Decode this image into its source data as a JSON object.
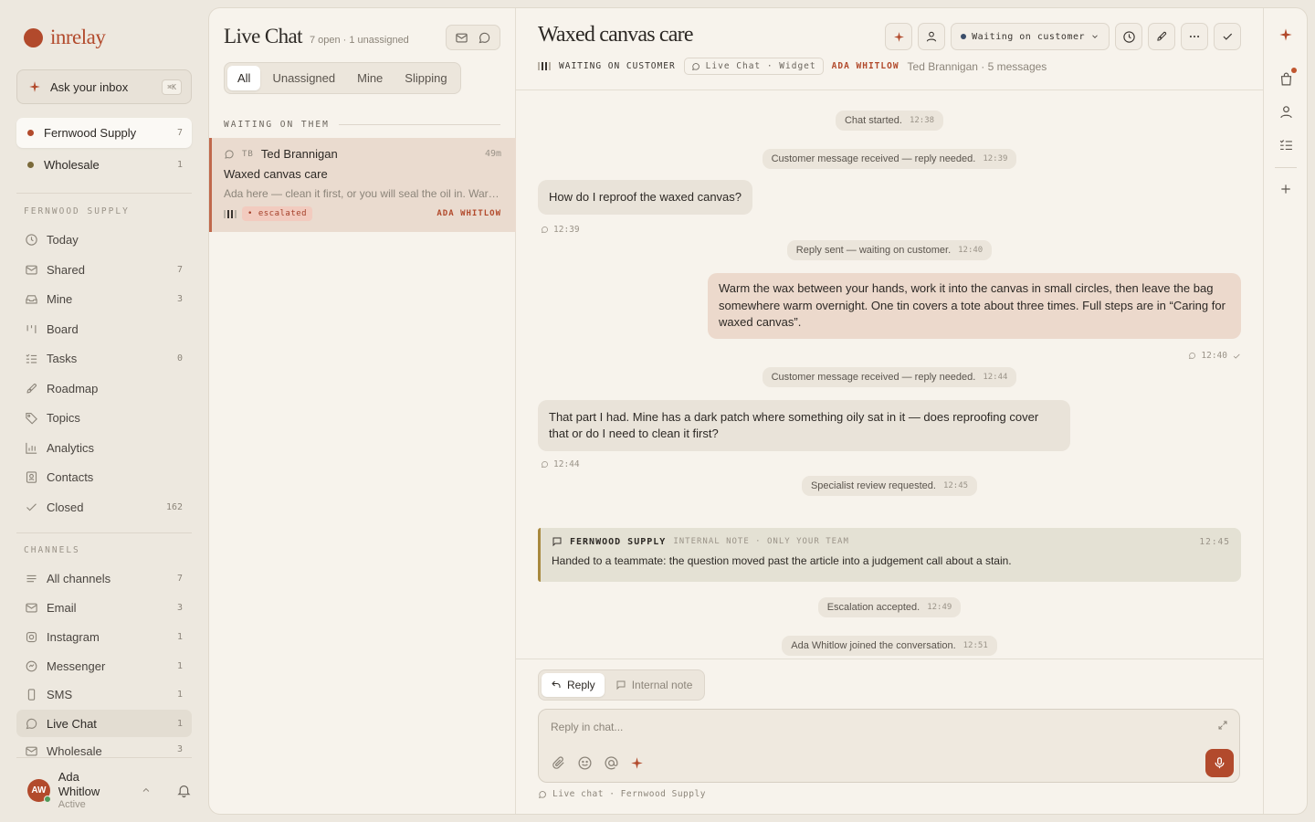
{
  "app": {
    "name": "inrelay",
    "ask_label": "Ask your inbox",
    "ask_shortcut": "⌘K",
    "accent": "#b24a2c"
  },
  "workspaces": [
    {
      "name": "Fernwood Supply",
      "count": "7",
      "dot_color": "#b24a2c"
    },
    {
      "name": "Wholesale",
      "count": "1",
      "dot_color": "#7a6a3a"
    }
  ],
  "nav": {
    "section_title": "FERNWOOD SUPPLY",
    "items": [
      {
        "label": "Today",
        "count": "",
        "icon": "clock-icon"
      },
      {
        "label": "Shared",
        "count": "7",
        "icon": "envelope-icon"
      },
      {
        "label": "Mine",
        "count": "3",
        "icon": "inbox-icon"
      },
      {
        "label": "Board",
        "count": "",
        "icon": "board-icon"
      },
      {
        "label": "Tasks",
        "count": "0",
        "icon": "tasks-icon"
      },
      {
        "label": "Roadmap",
        "count": "",
        "icon": "rocket-icon"
      },
      {
        "label": "Topics",
        "count": "",
        "icon": "tag-icon"
      },
      {
        "label": "Analytics",
        "count": "",
        "icon": "chart-icon"
      },
      {
        "label": "Contacts",
        "count": "",
        "icon": "contact-icon"
      },
      {
        "label": "Closed",
        "count": "162",
        "icon": "check-icon"
      }
    ]
  },
  "channels": {
    "section_title": "CHANNELS",
    "items": [
      {
        "label": "All channels",
        "count": "7",
        "icon": "list-icon"
      },
      {
        "label": "Email",
        "count": "3",
        "icon": "email-icon"
      },
      {
        "label": "Instagram",
        "count": "1",
        "icon": "instagram-icon"
      },
      {
        "label": "Messenger",
        "count": "1",
        "icon": "messenger-icon"
      },
      {
        "label": "SMS",
        "count": "1",
        "icon": "phone-icon"
      },
      {
        "label": "Live Chat",
        "count": "1",
        "icon": "chat-icon"
      },
      {
        "label": "Wholesale",
        "count": "3",
        "icon": "email-icon"
      }
    ]
  },
  "user": {
    "initials": "AW",
    "name": "Ada Whitlow",
    "status": "Active"
  },
  "list": {
    "title": "Live Chat",
    "subtitle": "7 open · 1 unassigned",
    "filters": [
      "All",
      "Unassigned",
      "Mine",
      "Slipping"
    ],
    "group_label": "WAITING ON THEM",
    "conversations": [
      {
        "initials": "TB",
        "name": "Ted Brannigan",
        "time": "49m",
        "subject": "Waxed canvas care",
        "preview": "Ada here — clean it first, or you will seal the oil in. Warm wat...",
        "badge": "• escalated",
        "assignee": "ADA WHITLOW"
      }
    ]
  },
  "conversation": {
    "title": "Waxed canvas care",
    "status_label": "WAITING ON CUSTOMER",
    "channel_pill": "Live Chat · Widget",
    "assignee": "ADA WHITLOW",
    "contact_meta": "Ted Brannigan · 5 messages",
    "status_dropdown": "Waiting on customer",
    "events": [
      {
        "text": "Chat started.",
        "time": "12:38"
      },
      {
        "text": "Customer message received — reply needed.",
        "time": "12:39"
      },
      {
        "text": "Reply sent — waiting on customer.",
        "time": "12:40"
      },
      {
        "text": "Customer message received — reply needed.",
        "time": "12:44"
      },
      {
        "text": "Specialist review requested.",
        "time": "12:45"
      },
      {
        "text": "Escalation accepted.",
        "time": "12:49"
      },
      {
        "text": "Ada Whitlow joined the conversation.",
        "time": "12:51"
      }
    ],
    "messages": [
      {
        "text": "How do I reproof the waxed canvas?",
        "time": "12:39"
      },
      {
        "text": "Warm the wax between your hands, work it into the canvas in small circles, then leave the bag somewhere warm overnight. One tin covers a tote about three times. Full steps are in “Caring for waxed canvas”.",
        "time": "12:40"
      },
      {
        "text": "That part I had. Mine has a dark patch where something oily sat in it — does reproofing cover that or do I need to clean it first?",
        "time": "12:44"
      }
    ],
    "note": {
      "author": "FERNWOOD SUPPLY",
      "label": "INTERNAL NOTE · ONLY YOUR TEAM",
      "time": "12:45",
      "text": "Handed to a teammate: the question moved past the article into a judgement call about a stain."
    }
  },
  "composer": {
    "mode_reply": "Reply",
    "mode_note": "Internal note",
    "placeholder": "Reply in chat...",
    "footer": "Live chat · Fernwood Supply"
  }
}
